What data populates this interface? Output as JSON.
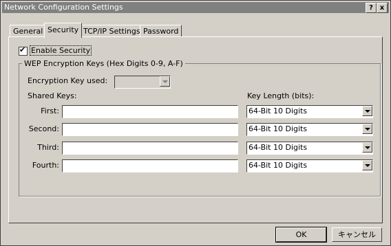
{
  "window": {
    "title": "Network Configuration Settings",
    "help_label": "?",
    "close_label": "x"
  },
  "tabs": [
    {
      "label": "General"
    },
    {
      "label": "Security"
    },
    {
      "label": "TCP/IP Settings"
    },
    {
      "label": "Password"
    }
  ],
  "security": {
    "enable_label": "Enable Security",
    "enable_checked": true,
    "group_title": "WEP Encryption Keys (Hex Digits 0-9, A-F)",
    "key_used_label": "Encryption Key used:",
    "key_used_value": "",
    "shared_keys_label": "Shared Keys:",
    "key_length_label": "Key Length (bits):",
    "keys": [
      {
        "label": "First:",
        "value": "",
        "length": "64-Bit  10 Digits"
      },
      {
        "label": "Second:",
        "value": "",
        "length": "64-Bit  10 Digits"
      },
      {
        "label": "Third:",
        "value": "",
        "length": "64-Bit  10 Digits"
      },
      {
        "label": "Fourth:",
        "value": "",
        "length": "64-Bit  10 Digits"
      }
    ]
  },
  "buttons": {
    "ok": "OK",
    "cancel": "キャンセル"
  }
}
